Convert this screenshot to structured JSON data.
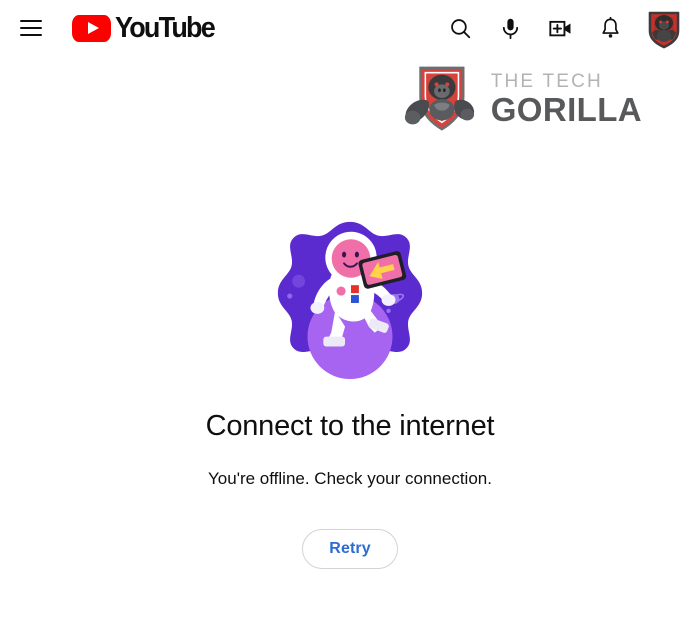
{
  "header": {
    "menu_icon": "hamburger-menu-icon",
    "logo": {
      "word": "YouTube",
      "play_icon": "youtube-play-icon",
      "country_code": ""
    },
    "actions": [
      {
        "name": "search-icon",
        "label": "Search"
      },
      {
        "name": "microphone-icon",
        "label": "Search with your voice"
      },
      {
        "name": "create-video-icon",
        "label": "Create"
      },
      {
        "name": "notifications-bell-icon",
        "label": "Notifications"
      }
    ],
    "avatar": {
      "name": "account-avatar",
      "label": "Account"
    }
  },
  "banner": {
    "brand": {
      "mark": "gorilla-shield-logo",
      "line_top": "THE TECH",
      "line_bottom": "GORILLA"
    }
  },
  "offline": {
    "illustration": "astronaut-offline-illustration",
    "title": "Connect to the internet",
    "subtitle": "You're offline. Check your connection.",
    "retry_label": "Retry"
  },
  "colors": {
    "youtube_red": "#ff0000",
    "link_blue": "#2b6cd4",
    "blob_purple": "#5b2bd0",
    "planet_purple": "#a764f0",
    "brand_gray_light": "#b3b3b3",
    "brand_gray_dark": "#58595b",
    "brand_red": "#d93a33",
    "text_primary": "#0f0f0f"
  }
}
